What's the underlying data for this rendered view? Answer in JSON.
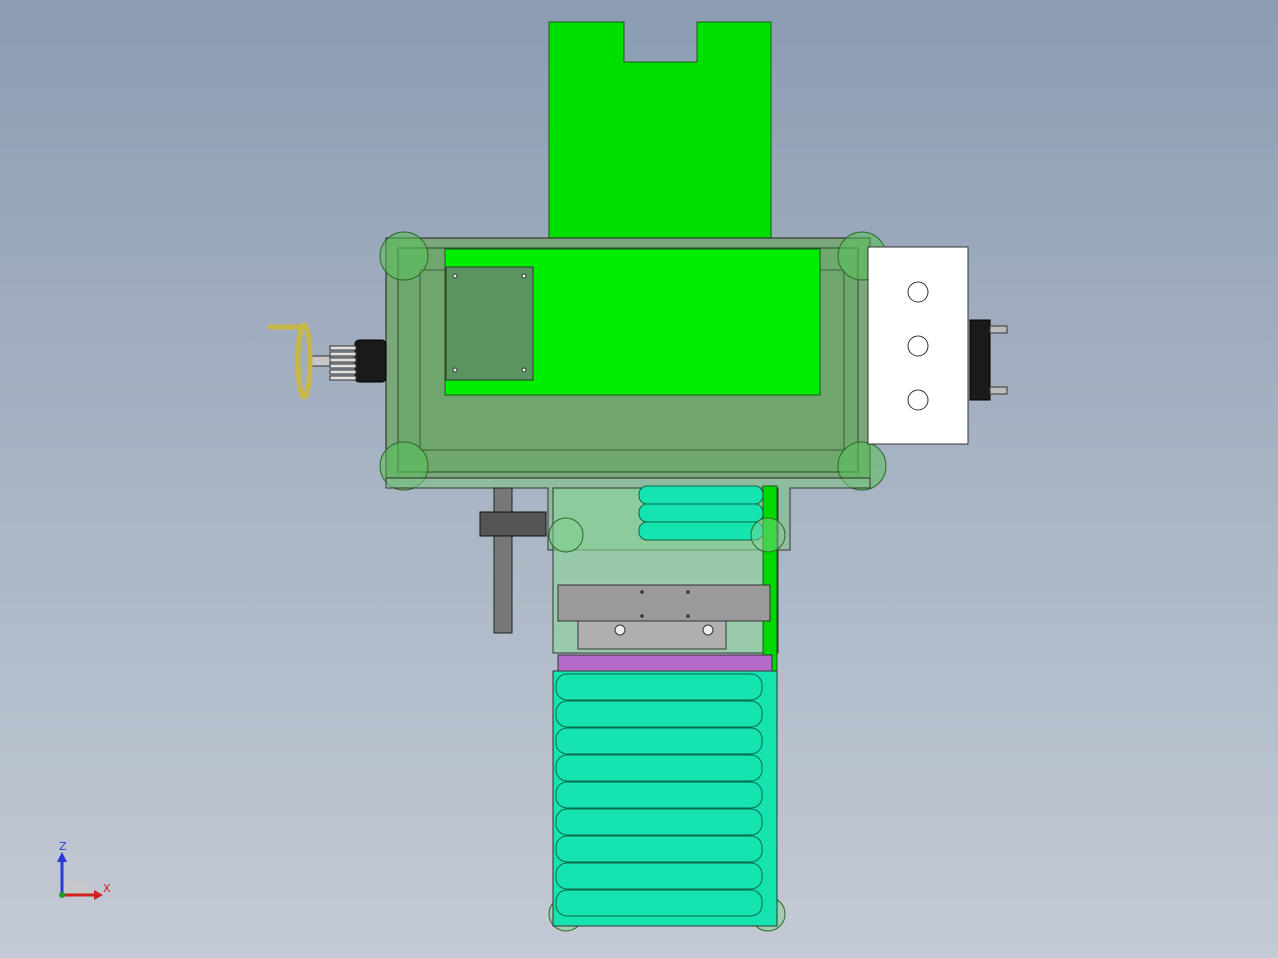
{
  "colors": {
    "background_top": "#8c9db2",
    "background_bottom": "#c4cad5",
    "green_bright": "#00e000",
    "green_light": "#00ef00",
    "green_muted": "#6fa86f",
    "green_transparent": "#7fc98a",
    "rollers": "#15e3b0",
    "steel": "#9a9a9a",
    "purple_strip": "#b46ac8",
    "white_plate": "#ffffff",
    "handwheel": "#d8c860",
    "outline": "#333333"
  },
  "triad": {
    "axis_z": "Z",
    "axis_x": "X",
    "z_color": "#2a3ad8",
    "x_color": "#d02020"
  },
  "icons": {
    "orientation_triad": "axis-triad-icon",
    "handwheel": "handwheel-icon"
  }
}
